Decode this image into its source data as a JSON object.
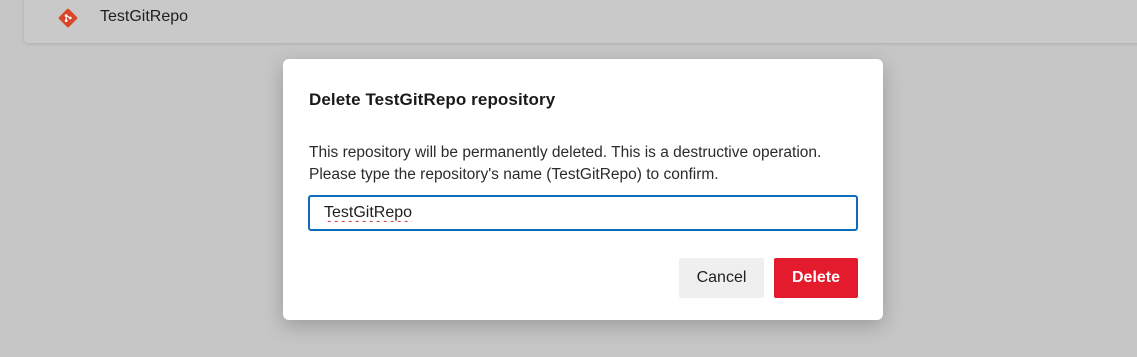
{
  "repo_bar": {
    "repo_name": "TestGitRepo",
    "icon": "git-repo-icon",
    "icon_color": "#d9472b"
  },
  "dialog": {
    "title": "Delete TestGitRepo repository",
    "description": "This repository will be permanently deleted. This is a destructive operation. Please type the repository's name (TestGitRepo) to confirm.",
    "confirm_input": {
      "value": "TestGitRepo",
      "focus_color": "#0f6cbd"
    },
    "cancel_label": "Cancel",
    "delete_label": "Delete",
    "delete_color": "#e31b2c"
  }
}
